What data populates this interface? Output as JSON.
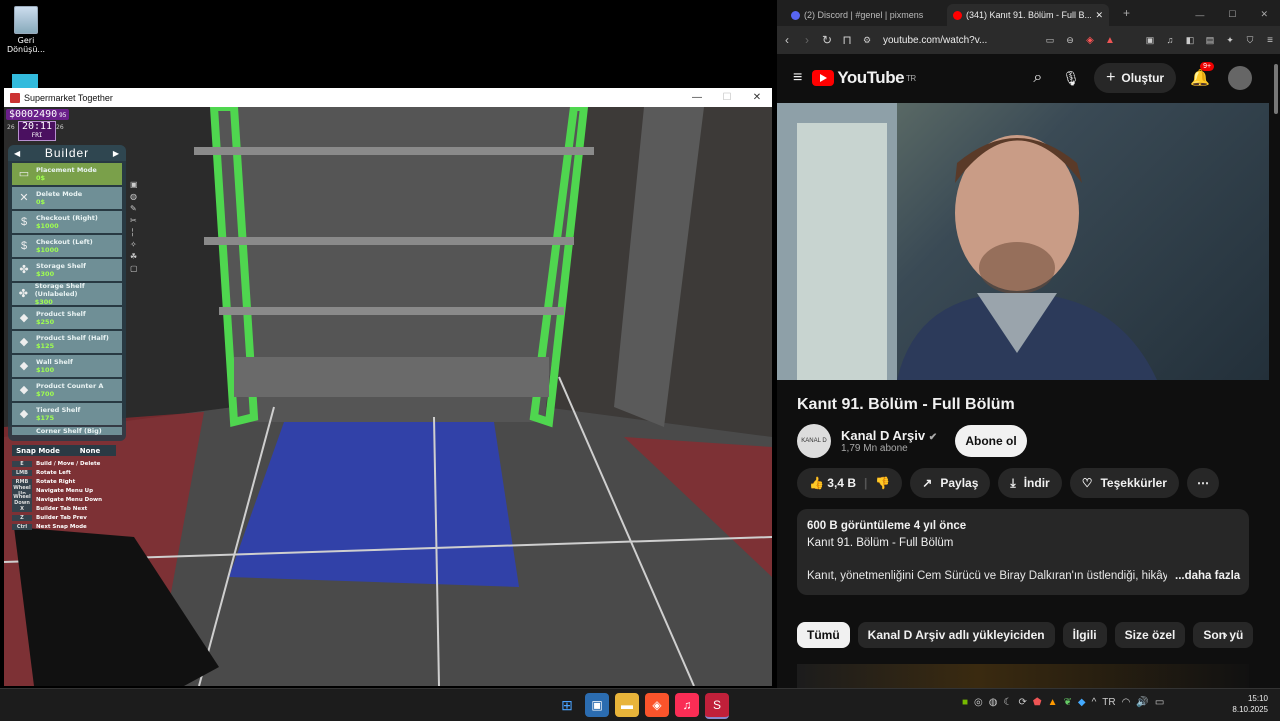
{
  "desktop": {
    "recycle_bin_label": "Geri Dönüşü..."
  },
  "game_window": {
    "title": "Supermarket Together",
    "controls": {
      "minimize": "—",
      "maximize": "☐",
      "close": "✕"
    },
    "hud": {
      "money": "$0002490",
      "money_suffix": "95",
      "time": "20:11",
      "day": "FRI",
      "left_num": "26",
      "right_num": "26"
    },
    "builder": {
      "title": "Builder",
      "prev": "◀",
      "next": "▶",
      "items": [
        {
          "name": "Placement Mode",
          "price": "0$",
          "icon": "▭"
        },
        {
          "name": "Delete Mode",
          "price": "0$",
          "icon": "✕"
        },
        {
          "name": "Checkout (Right)",
          "price": "$1000",
          "icon": "$"
        },
        {
          "name": "Checkout (Left)",
          "price": "$1000",
          "icon": "$"
        },
        {
          "name": "Storage Shelf",
          "price": "$300",
          "icon": "✤"
        },
        {
          "name": "Storage Shelf (Unlabeled)",
          "price": "$300",
          "icon": "✤"
        },
        {
          "name": "Product Shelf",
          "price": "$250",
          "icon": "◆"
        },
        {
          "name": "Product Shelf (Half)",
          "price": "$125",
          "icon": "◆"
        },
        {
          "name": "Wall Shelf",
          "price": "$100",
          "icon": "◆"
        },
        {
          "name": "Product Counter A",
          "price": "$700",
          "icon": "◆"
        },
        {
          "name": "Tiered Shelf",
          "price": "$175",
          "icon": "◆"
        }
      ],
      "cut_item": "Corner Shelf (Big)"
    },
    "snap_mode": {
      "label": "Snap Mode",
      "value": "None"
    },
    "keybinds": [
      {
        "key": "E",
        "action": "Build / Move / Delete"
      },
      {
        "key": "LMB",
        "action": "Rotate Left"
      },
      {
        "key": "RMB",
        "action": "Rotate Right"
      },
      {
        "key": "Wheel Up",
        "action": "Navigate Menu Up"
      },
      {
        "key": "Wheel Down",
        "action": "Navigate Menu Down"
      },
      {
        "key": "X",
        "action": "Builder Tab Next"
      },
      {
        "key": "Z",
        "action": "Builder Tab Prev"
      },
      {
        "key": "Ctrl",
        "action": "Next Snap Mode"
      }
    ]
  },
  "browser": {
    "tabs": [
      {
        "label": "(2) Discord | #genel | pixmens",
        "active": false,
        "fav_color": "#5865f2"
      },
      {
        "label": "(341) Kanıt 91. Bölüm - Full B...",
        "active": true,
        "fav_color": "#ff0000"
      }
    ],
    "new_tab": "+",
    "url": "youtube.com/watch?v...",
    "youtube": {
      "logo": "YouTube",
      "region": "TR",
      "create_label": "Oluştur",
      "notif_count": "9+",
      "video_title": "Kanıt 91. Bölüm - Full Bölüm",
      "channel_name": "Kanal D Arşiv",
      "channel_subs": "1,79 Mn abone",
      "channel_avatar": "KANAL D",
      "subscribe_label": "Abone ol",
      "likes": "3,4 B",
      "share_label": "Paylaş",
      "download_label": "İndir",
      "thanks_label": "Teşekkürler",
      "desc_stats": "600 B görüntüleme  4 yıl önce",
      "desc_title": "Kanıt 91. Bölüm - Full Bölüm",
      "desc_text": "Kanıt, yönetmenliğini Cem Sürücü ve Biray Dalkıran'ın üstlendiği, hikâye",
      "desc_more": "...daha fazla",
      "chips": [
        "Tümü",
        "Kanal D Arşiv adlı yükleyiciden",
        "İlgili",
        "Size özel",
        "Son yü"
      ]
    }
  },
  "taskbar": {
    "time": "15:10",
    "date": "8.10.2025"
  }
}
